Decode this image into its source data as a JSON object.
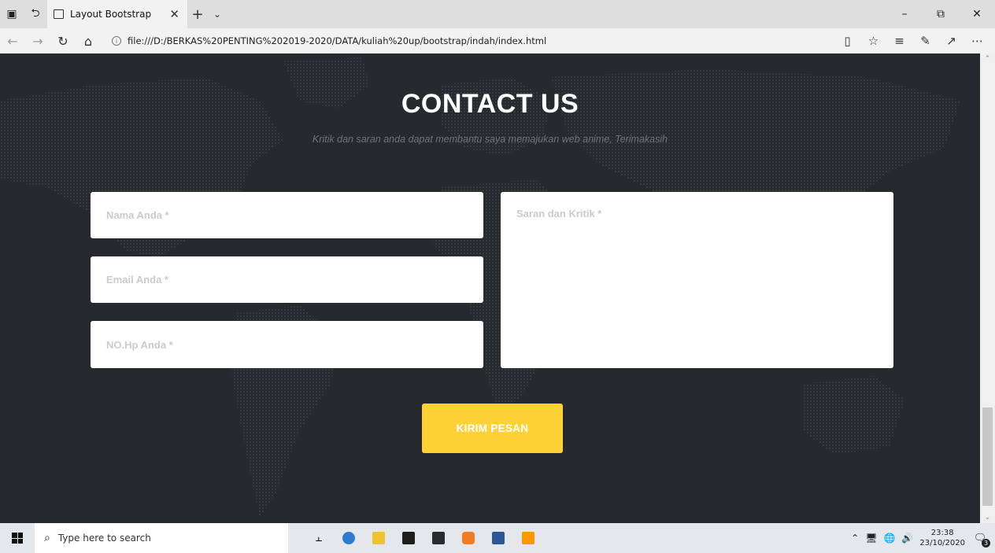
{
  "browser": {
    "tab_title": "Layout Bootstrap",
    "url": "file:///D:/BERKAS%20PENTING%202019-2020/DATA/kuliah%20up/bootstrap/indah/index.html",
    "icons": [
      "tab-preview-icon",
      "set-aside-tabs-icon",
      "page-icon",
      "close-icon",
      "new-tab-icon",
      "tab-menu-icon",
      "minimize-icon",
      "restore-icon",
      "close-window-icon",
      "back-icon",
      "forward-icon",
      "refresh-icon",
      "home-icon",
      "info-icon",
      "reading-view-icon",
      "favorite-icon",
      "favorites-list-icon",
      "pen-icon",
      "share-icon",
      "more-icon"
    ]
  },
  "contact": {
    "title": "CONTACT US",
    "subtitle": "Kritik dan saran anda dapat membantu saya memajukan web anime, Terimakasih",
    "name_placeholder": "Nama Anda *",
    "email_placeholder": "Email Anda *",
    "phone_placeholder": "NO.Hp Anda *",
    "message_placeholder": "Saran dan Kritik *",
    "submit_label": "KIRIM PESAN",
    "accent_color": "#fed136",
    "background_color": "#26292e"
  },
  "taskbar": {
    "search_placeholder": "Type here to search",
    "time": "23:38",
    "date": "23/10/2020",
    "notification_count": "3",
    "apps": [
      "task-view-icon",
      "edge-icon",
      "file-explorer-icon",
      "store-icon",
      "mail-icon",
      "paint-icon",
      "word-icon",
      "sublime-icon"
    ]
  }
}
